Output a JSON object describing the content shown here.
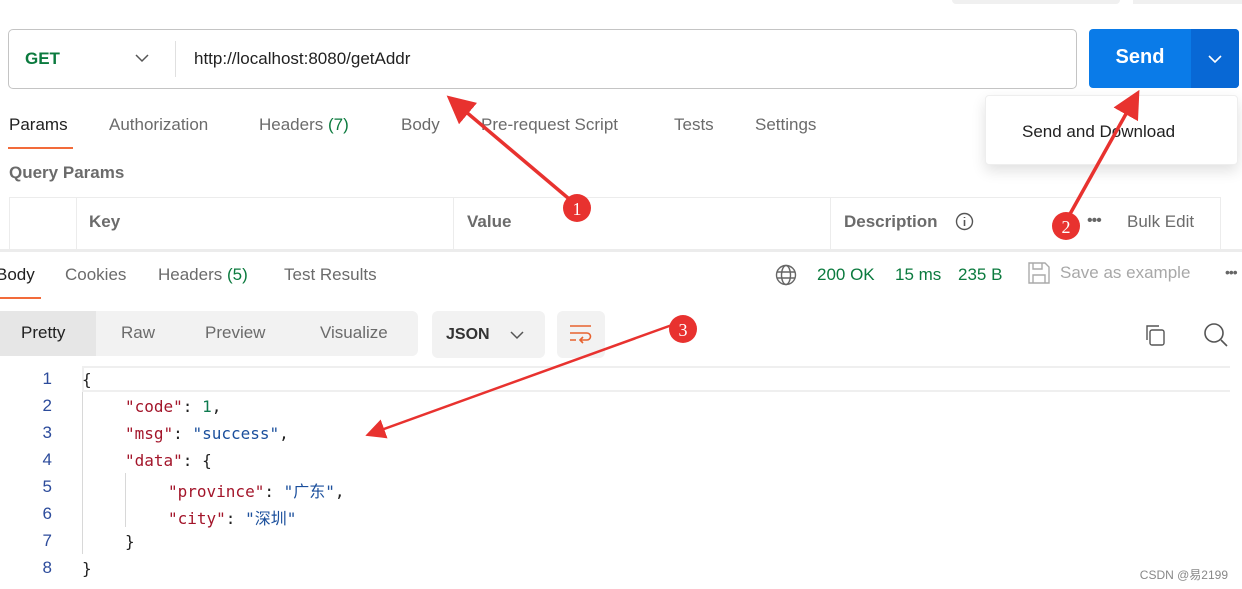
{
  "request": {
    "method": "GET",
    "url": "http://localhost:8080/getAddr",
    "send_label": "Send",
    "send_menu_item": "Send and Download",
    "tabs": [
      {
        "label": "Params"
      },
      {
        "label": "Authorization"
      },
      {
        "label": "Headers",
        "count": "(7)"
      },
      {
        "label": "Body"
      },
      {
        "label": "Pre-request Script"
      },
      {
        "label": "Tests"
      },
      {
        "label": "Settings"
      }
    ],
    "query_params_title": "Query Params",
    "table_headers": {
      "key": "Key",
      "value": "Value",
      "description": "Description",
      "bulk_edit": "Bulk Edit"
    }
  },
  "response": {
    "tabs": [
      {
        "label": "Body"
      },
      {
        "label": "Cookies"
      },
      {
        "label": "Headers",
        "count": "(5)"
      },
      {
        "label": "Test Results"
      }
    ],
    "status": "200 OK",
    "time": "15 ms",
    "size": "235 B",
    "save_example": "Save as example",
    "views": [
      "Pretty",
      "Raw",
      "Preview",
      "Visualize"
    ],
    "format": "JSON",
    "lines": [
      "1",
      "2",
      "3",
      "4",
      "5",
      "6",
      "7",
      "8"
    ],
    "code": {
      "open": "{",
      "code_key": "\"code\"",
      "code_val": "1",
      "msg_key": "\"msg\"",
      "msg_val": "\"success\"",
      "data_key": "\"data\"",
      "data_open": "{",
      "province_key": "\"province\"",
      "province_val": "\"广东\"",
      "city_key": "\"city\"",
      "city_val": "\"深圳\"",
      "data_close": "}",
      "close": "}"
    }
  },
  "annotations": [
    "1",
    "2",
    "3"
  ],
  "watermark": "CSDN @易2199",
  "colors": {
    "accent": "#0a7be8",
    "tab_underline": "#f26b3a",
    "status": "#0b7a3e",
    "annotation": "#e8322f"
  }
}
